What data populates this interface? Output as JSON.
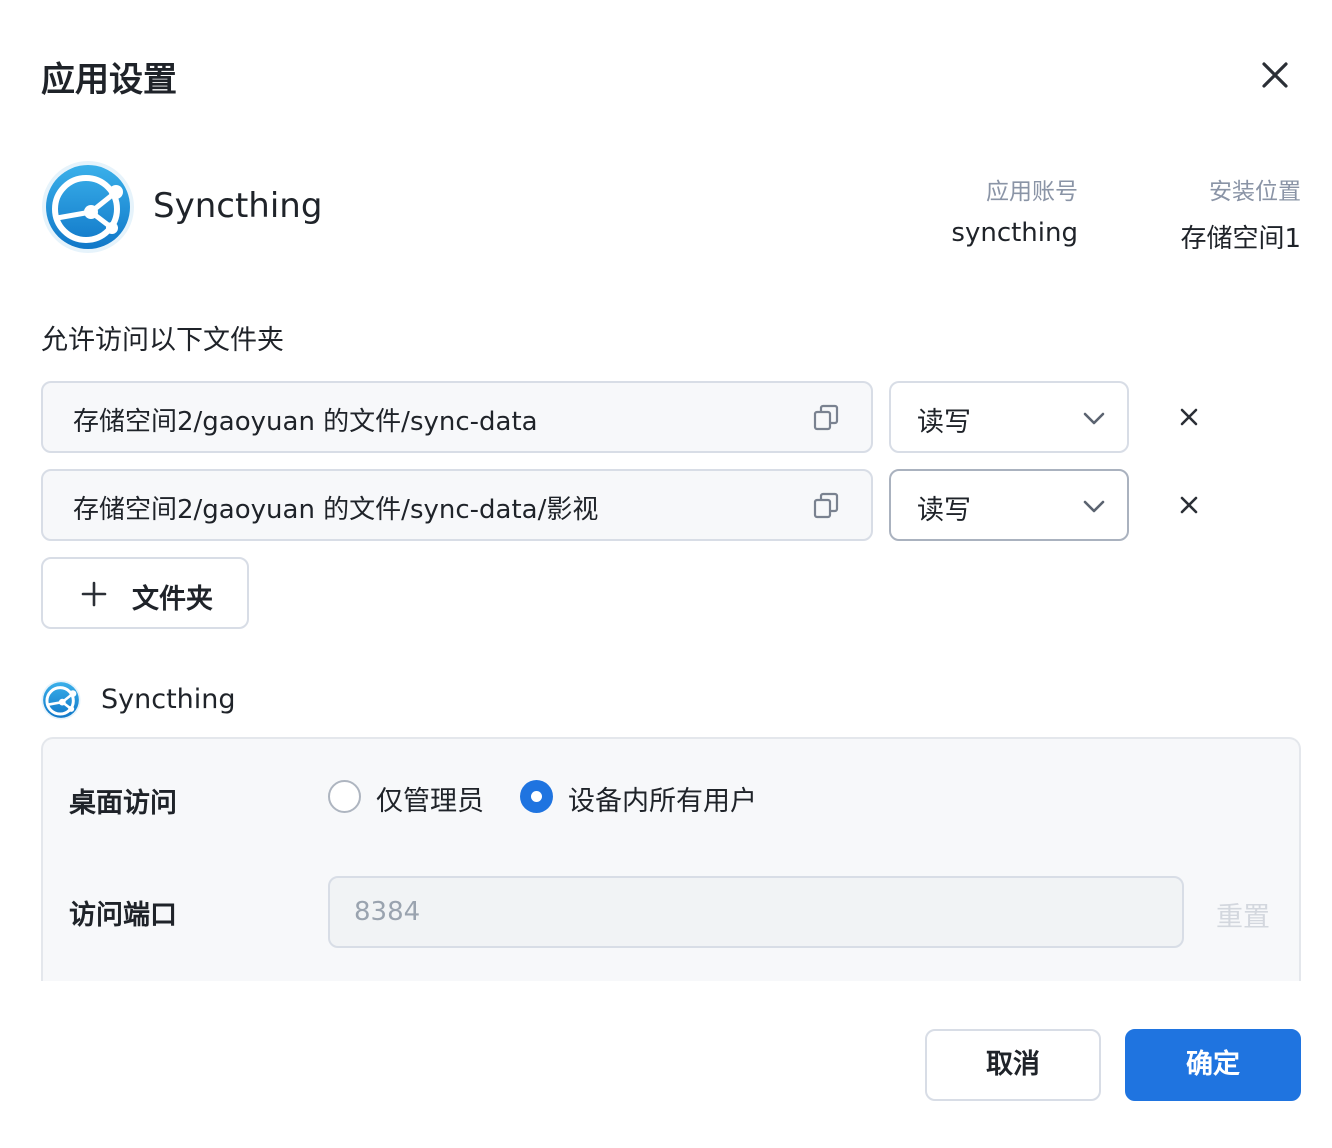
{
  "dialog": {
    "title": "应用设置",
    "close_icon": "close-icon"
  },
  "app": {
    "name": "Syncthing",
    "logo_icon": "syncthing-logo-icon",
    "account_label": "应用账号",
    "account_value": "syncthing",
    "location_label": "安装位置",
    "location_value": "存储空间1"
  },
  "folders": {
    "section_label": "允许访问以下文件夹",
    "items": [
      {
        "path": "存储空间2/gaoyuan 的文件/sync-data",
        "permission": "读写"
      },
      {
        "path": "存储空间2/gaoyuan 的文件/sync-data/影视",
        "permission": "读写"
      }
    ],
    "add_button_label": "文件夹"
  },
  "service": {
    "name": "Syncthing",
    "desktop_access_label": "桌面访问",
    "options": [
      {
        "label": "仅管理员",
        "checked": false
      },
      {
        "label": "设备内所有用户",
        "checked": true
      }
    ],
    "port_label": "访问端口",
    "port_value": "8384",
    "reset_label": "重置"
  },
  "footer": {
    "cancel_label": "取消",
    "confirm_label": "确定"
  },
  "colors": {
    "primary": "#1f74e0",
    "border": "#d8dde6",
    "muted_text": "#8a94a6"
  }
}
